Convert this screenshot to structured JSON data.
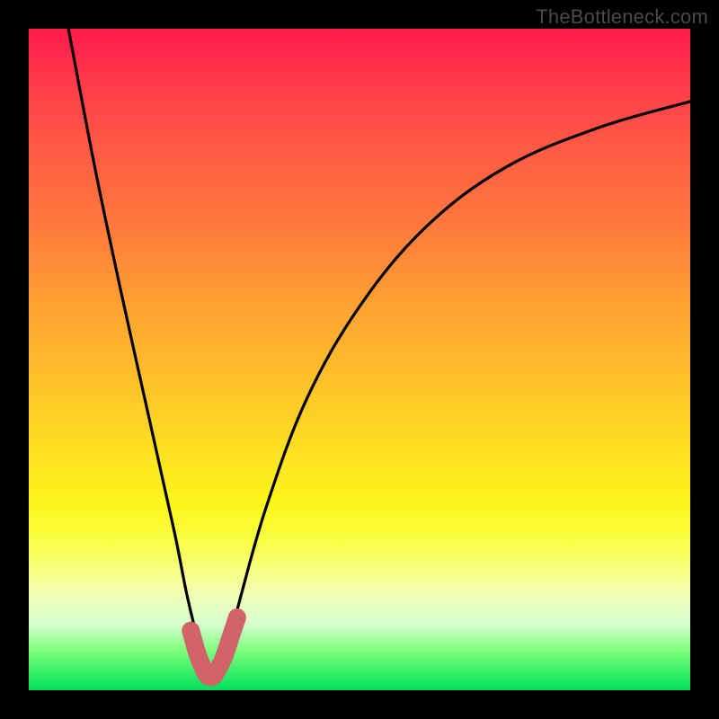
{
  "watermark": "TheBottleneck.com",
  "chart_data": {
    "type": "line",
    "title": "",
    "xlabel": "",
    "ylabel": "",
    "xlim": [
      0,
      100
    ],
    "ylim": [
      0,
      100
    ],
    "grid": false,
    "series": [
      {
        "name": "bottleneck-curve",
        "color": "#000000",
        "x": [
          6,
          10,
          14,
          18,
          22,
          24,
          26,
          27,
          28,
          29,
          30,
          32,
          36,
          42,
          50,
          60,
          72,
          86,
          100
        ],
        "values": [
          100,
          79,
          60,
          42,
          24,
          14,
          6,
          3,
          2,
          3,
          6,
          14,
          28,
          44,
          58,
          70,
          79,
          85,
          89
        ]
      },
      {
        "name": "highlight-u",
        "color": "#d1646b",
        "x": [
          24.5,
          25.5,
          26.5,
          27.0,
          27.5,
          28.0,
          28.5,
          29.5,
          30.5,
          31.5
        ],
        "values": [
          9.0,
          5.5,
          3.0,
          2.2,
          2.0,
          2.2,
          3.0,
          5.0,
          8.0,
          11.0
        ]
      }
    ],
    "annotations": []
  }
}
